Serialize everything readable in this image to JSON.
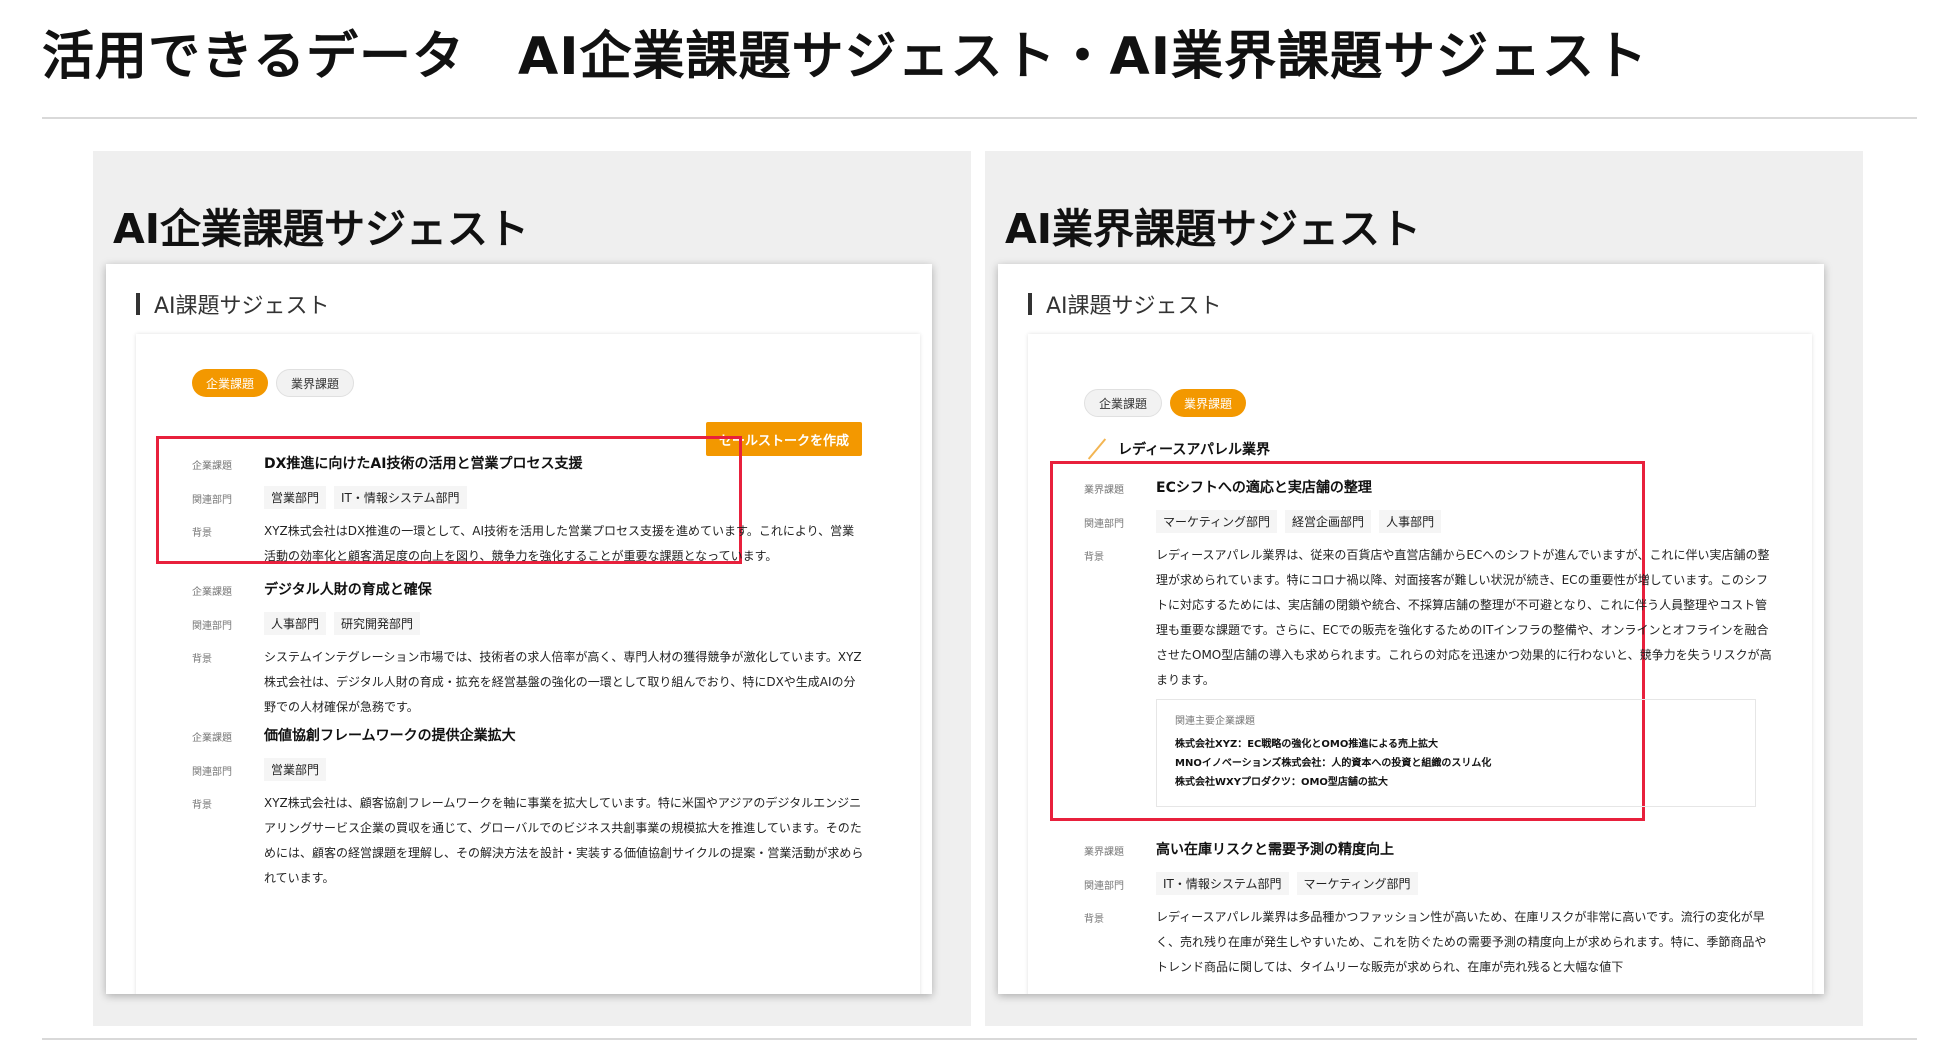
{
  "page": {
    "title": "活用できるデータ　AI企業課題サジェスト・AI業界課題サジェスト"
  },
  "colors": {
    "accent": "#f39800",
    "highlight": "#e8203c"
  },
  "left": {
    "heading": "AI企業課題サジェスト",
    "card_title": "AI課題サジェスト",
    "tabs": [
      {
        "label": "企業課題"
      },
      {
        "label": "業界課題"
      }
    ],
    "active_tab": "企業課題",
    "sales_button": "セールストークを作成",
    "items": [
      {
        "type_label": "企業課題",
        "title": "DX推進に向けたAI技術の活用と営業プロセス支援",
        "dept_label": "関連部門",
        "depts": [
          "営業部門",
          "IT・情報システム部門"
        ],
        "bg_label": "背景",
        "background": "XYZ株式会社はDX推進の一環として、AI技術を活用した営業プロセス支援を進めています。これにより、営業活動の効率化と顧客満足度の向上を図り、競争力を強化することが重要な課題となっています。"
      },
      {
        "type_label": "企業課題",
        "title": "デジタル人財の育成と確保",
        "dept_label": "関連部門",
        "depts": [
          "人事部門",
          "研究開発部門"
        ],
        "bg_label": "背景",
        "background": "システムインテグレーション市場では、技術者の求人倍率が高く、専門人材の獲得競争が激化しています。XYZ株式会社は、デジタル人財の育成・拡充を経営基盤の強化の一環として取り組んでおり、特にDXや生成AIの分野での人材確保が急務です。"
      },
      {
        "type_label": "企業課題",
        "title": "価値協創フレームワークの提供企業拡大",
        "dept_label": "関連部門",
        "depts": [
          "営業部門"
        ],
        "bg_label": "背景",
        "background": "XYZ株式会社は、顧客協創フレームワークを軸に事業を拡大しています。特に米国やアジアのデジタルエンジニアリングサービス企業の買収を通じて、グローバルでのビジネス共創事業の規模拡大を推進しています。そのためには、顧客の経営課題を理解し、その解決方法を設計・実装する価値協創サイクルの提案・営業活動が求められています。"
      }
    ]
  },
  "right": {
    "heading": "AI業界課題サジェスト",
    "card_title": "AI課題サジェスト",
    "tabs": [
      {
        "label": "企業課題"
      },
      {
        "label": "業界課題"
      }
    ],
    "active_tab": "業界課題",
    "industry": "レディースアパレル業界",
    "items": [
      {
        "type_label": "業界課題",
        "title": "ECシフトへの適応と実店舗の整理",
        "dept_label": "関連部門",
        "depts": [
          "マーケティング部門",
          "経営企画部門",
          "人事部門"
        ],
        "bg_label": "背景",
        "background": "レディースアパレル業界は、従来の百貨店や直営店舗からECへのシフトが進んでいますが、これに伴い実店舗の整理が求められています。特にコロナ禍以降、対面接客が難しい状況が続き、ECの重要性が増しています。このシフトに対応するためには、実店舗の閉鎖や統合、不採算店舗の整理が不可避となり、これに伴う人員整理やコスト管理も重要な課題です。さらに、ECでの販売を強化するためのITインフラの整備や、オンラインとオフラインを融合させたOMO型店舗の導入も求められます。これらの対応を迅速かつ効果的に行わないと、競争力を失うリスクが高まります。",
        "related_label": "関連主要企業課題",
        "related": [
          "株式会社XYZ：EC戦略の強化とOMO推進による売上拡大",
          "MNOイノベーションズ株式会社：人的資本への投資と組織のスリム化",
          "株式会社WXYプロダクツ：OMO型店舗の拡大"
        ]
      },
      {
        "type_label": "業界課題",
        "title": "高い在庫リスクと需要予測の精度向上",
        "dept_label": "関連部門",
        "depts": [
          "IT・情報システム部門",
          "マーケティング部門"
        ],
        "bg_label": "背景",
        "background": "レディースアパレル業界は多品種かつファッション性が高いため、在庫リスクが非常に高いです。流行の変化が早く、売れ残り在庫が発生しやすいため、これを防ぐための需要予測の精度向上が求められます。特に、季節商品やトレンド商品に関しては、タイムリーな販売が求められ、在庫が売れ残ると大幅な値下"
      }
    ]
  }
}
